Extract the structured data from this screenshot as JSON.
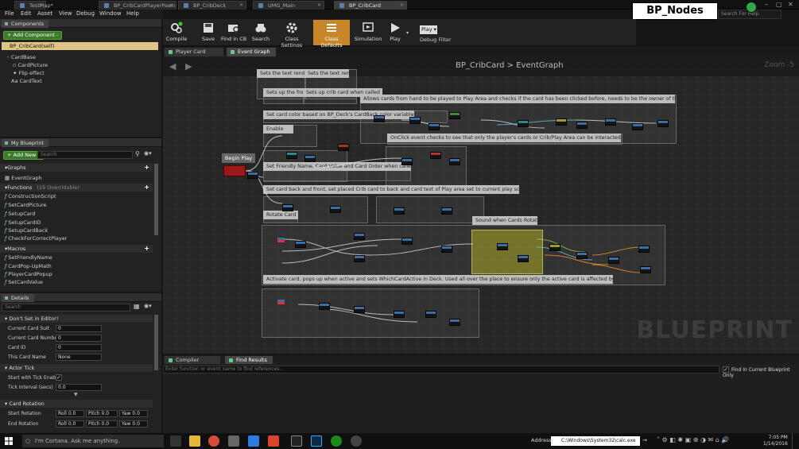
{
  "window": {
    "doc_tabs": [
      "TestMap*",
      "BP_CribCardPlayerPawn",
      "BP_CribDeck",
      "UMG_Main",
      "BP_CribCard"
    ],
    "active_tab": "BP_CribCard"
  },
  "menu": [
    "File",
    "Edit",
    "Asset",
    "View",
    "Debug",
    "Window",
    "Help"
  ],
  "overlay_label": "BP_Nodes",
  "search_help": "Search For Help",
  "components": {
    "tab": "Components",
    "add_label": "+ Add Component -",
    "self": "BP_CribCard(self)",
    "items": [
      "CardBase",
      "CardPicture",
      "Flip effect",
      "CardText"
    ]
  },
  "my_blueprint": {
    "tab": "My Blueprint",
    "add_new": "+ Add New -",
    "search_placeholder": "Search",
    "graphs_label": "Graphs",
    "event_graph": "EventGraph",
    "functions_label": "Functions",
    "functions_count": "(19 Overridable)",
    "functions": [
      "ConstructionScript",
      "SetCardPicture",
      "SetupCard",
      "SetupCardID",
      "SetupCardBack",
      "CheckForCorrectPlayer"
    ],
    "macros_label": "Macros",
    "macros": [
      "SetFriendlyName",
      "CardPop-UpMath",
      "PlayerCardPopup",
      "SetCardValue"
    ]
  },
  "details": {
    "tab": "Details",
    "search_placeholder": "Search",
    "dont_set": "Don't Set in Editor!",
    "rows": [
      {
        "label": "Current Card Suit",
        "value": "0"
      },
      {
        "label": "Current Card Number",
        "value": "0"
      },
      {
        "label": "Card ID",
        "value": "0"
      },
      {
        "label": "This Card Name",
        "value": "None"
      }
    ],
    "actor_tick": "Actor Tick",
    "start_tick": "Start with Tick Enable",
    "start_tick_check": "✓",
    "tick_interval": "Tick Interval (secs)",
    "tick_value": "0.0",
    "card_rotation": "Card Rotation",
    "start_rotation": "Start Rotation",
    "end_rotation": "End Rotation",
    "rot_fields": [
      "Roll",
      "0.0",
      "Pitch",
      "0.0",
      "Yaw",
      "0.0"
    ]
  },
  "toolbar": {
    "buttons": [
      "Compile",
      "Save",
      "Find in CB",
      "Search",
      "Class Settings",
      "Class Defaults",
      "Simulation",
      "Play"
    ],
    "play_drop": "Play ▾",
    "debug_filter": "Debug Filter"
  },
  "graph_tabs": [
    "Player Card Popup",
    "Event Graph"
  ],
  "graph": {
    "breadcrumb": "BP_CribCard  >  EventGraph",
    "zoom": "Zoom -5",
    "watermark": "BLUEPRINT",
    "begin_play": "Begin Play",
    "comments": [
      "Sets the text render component when called",
      "Sets up the front of card",
      "Sets up crib card when called",
      "Allows cards from hand to be played to Play Area and checks if the card has been clicked before, needs to be the owner of the crib",
      "Set card color based on BP_Deck's CardBack color variable",
      "Enable",
      "OnClick event checks to see that only the player's cards or Crib/Play Area can be interacted with",
      "Set Friendly Name, Card Value and Card Order when called",
      "Set card back and front, set placed Crib card to back and card text of Play area set to current play score",
      "Rotate Card",
      "Sound when Cards Rotate",
      "Activate card, pops up when active and sets WhichCardActive in Deck. Used all over the place to ensure only the active card is affected by functions."
    ]
  },
  "results": {
    "tabs": [
      "Compiler Results",
      "Find Results"
    ],
    "find_placeholder": "Enter function or event name to find references...",
    "find_in_current": "Find In Current Blueprint Only",
    "check": "✓"
  },
  "taskbar": {
    "cortana": "I'm Cortana. Ask me anything.",
    "address_label": "Address",
    "address": "C:\\Windows\\System32\\calc.exe",
    "time": "7:05 PM",
    "date": "1/14/2016"
  }
}
